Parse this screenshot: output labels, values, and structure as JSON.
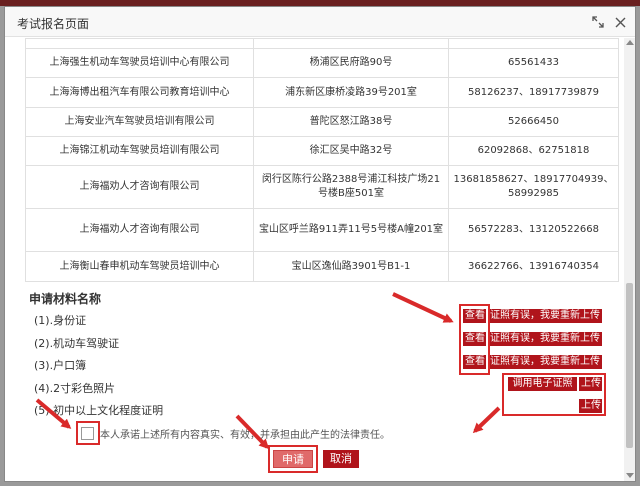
{
  "dialog": {
    "title": "考试报名页面",
    "maximize_icon": "maximize-icon",
    "close_icon": "close-icon"
  },
  "schools": [
    {
      "name": "",
      "address": "",
      "phone": ""
    },
    {
      "name": "上海强生机动车驾驶员培训中心有限公司",
      "address": "杨浦区民府路90号",
      "phone": "65561433"
    },
    {
      "name": "上海海博出租汽车有限公司教育培训中心",
      "address": "浦东新区康桥凌路39号201室",
      "phone": "58126237、18917739879"
    },
    {
      "name": "上海安业汽车驾驶员培训有限公司",
      "address": "普陀区怒江路38号",
      "phone": "52666450"
    },
    {
      "name": "上海锦江机动车驾驶员培训有限公司",
      "address": "徐汇区吴中路32号",
      "phone": "62092868、62751818"
    },
    {
      "name": "上海福劝人才咨询有限公司",
      "address": "闵行区陈行公路2388号浦江科技广场21号楼B座501室",
      "phone": "13681858627、18917704939、58992985"
    },
    {
      "name": "上海福劝人才咨询有限公司",
      "address": "宝山区呼兰路911弄11号5号楼A幢201室",
      "phone": "56572283、13120522668"
    },
    {
      "name": "上海衡山春申机动车驾驶员培训中心",
      "address": "宝山区逸仙路3901号B1-1",
      "phone": "36622766、13916740354"
    }
  ],
  "materials": {
    "title": "申请材料名称",
    "items": [
      "(1).身份证",
      "(2).机动车驾驶证",
      "(3).户口簿",
      "(4).2寸彩色照片",
      "(5).初中以上文化程度证明"
    ],
    "view_label": "查看",
    "reupload_label": "证照有误，我要重新上传",
    "use_ecert_label": "调用电子证照",
    "upload_label": "上传"
  },
  "pledge": "本人承诺上述所有内容真实、有效，并承担由此产生的法律责任。",
  "actions": {
    "apply": "申请",
    "cancel": "取消"
  },
  "colors": {
    "accent_red": "#b0141b",
    "annotation_red": "#d92a2a",
    "apply_pink": "#e06a6a"
  }
}
